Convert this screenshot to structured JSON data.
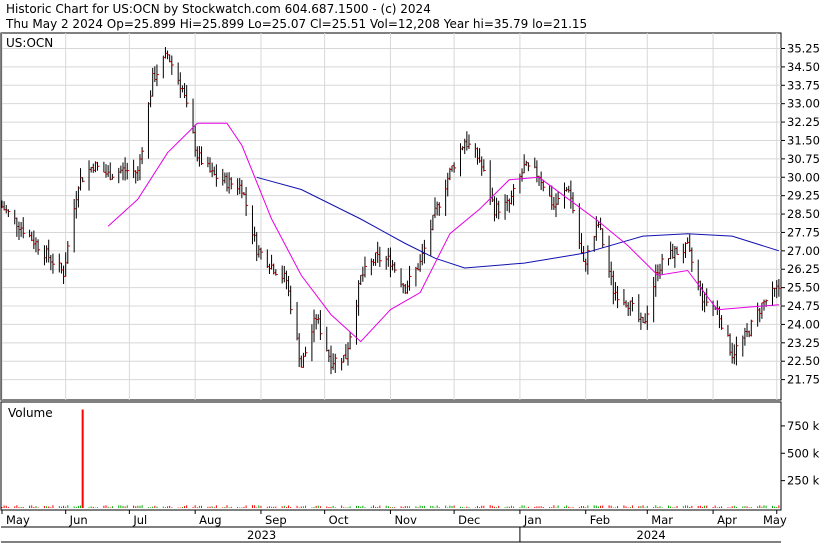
{
  "header": {
    "line1": "Historic Chart for US:OCN by Stockwatch.com 604.687.1500 - (c) 2024",
    "line2": "Thu May  2 2024  Op=25.899  Hi=25.899  Lo=25.07  Cl=25.51  Vol=12,208  Year hi=35.79  lo=21.15"
  },
  "chart_data": [
    {
      "type": "line",
      "title": "US:OCN",
      "ylim": [
        21.0,
        35.8
      ],
      "y_ticks": [
        "35.25",
        "34.50",
        "33.75",
        "33.00",
        "32.25",
        "31.50",
        "30.75",
        "30.00",
        "29.25",
        "28.50",
        "27.75",
        "27.00",
        "26.25",
        "25.50",
        "24.75",
        "24.00",
        "23.25",
        "22.50",
        "21.75"
      ],
      "x_ticks": [
        "May",
        "Jun",
        "Jul",
        "Aug",
        "Sep",
        "Oct",
        "Nov",
        "Dec",
        "Jan",
        "Feb",
        "Mar",
        "Apr",
        "May"
      ],
      "year_labels": [
        "2023",
        "2024"
      ],
      "series": [
        {
          "name": "price",
          "color": "#000000",
          "x": [
            "2023-05-02",
            "2023-05-15",
            "2023-05-31",
            "2023-06-07",
            "2023-06-14",
            "2023-06-21",
            "2023-06-28",
            "2023-07-05",
            "2023-07-12",
            "2023-07-19",
            "2023-07-26",
            "2023-08-02",
            "2023-08-09",
            "2023-08-16",
            "2023-08-23",
            "2023-08-30",
            "2023-09-06",
            "2023-09-13",
            "2023-09-20",
            "2023-09-27",
            "2023-10-04",
            "2023-10-11",
            "2023-10-18",
            "2023-10-25",
            "2023-11-01",
            "2023-11-08",
            "2023-11-15",
            "2023-11-22",
            "2023-11-29",
            "2023-12-06",
            "2023-12-13",
            "2023-12-20",
            "2023-12-27",
            "2024-01-03",
            "2024-01-10",
            "2024-01-17",
            "2024-01-24",
            "2024-01-31",
            "2024-02-07",
            "2024-02-14",
            "2024-02-21",
            "2024-02-28",
            "2024-03-06",
            "2024-03-13",
            "2024-03-20",
            "2024-03-27",
            "2024-04-03",
            "2024-04-10",
            "2024-04-17",
            "2024-04-24",
            "2024-05-02"
          ],
          "values": [
            28.8,
            27.6,
            26.1,
            29.8,
            30.5,
            30.1,
            30.3,
            30.2,
            34.0,
            35.0,
            33.6,
            30.9,
            30.1,
            29.8,
            29.6,
            27.1,
            26.4,
            25.8,
            22.3,
            24.3,
            22.5,
            22.7,
            25.9,
            26.7,
            26.6,
            25.5,
            26.5,
            28.5,
            30.2,
            31.5,
            30.7,
            28.7,
            28.9,
            30.4,
            30.1,
            28.8,
            29.6,
            26.4,
            28.1,
            25.4,
            24.9,
            23.9,
            26.3,
            26.9,
            27.1,
            25.1,
            24.6,
            22.8,
            23.6,
            24.8,
            25.5
          ]
        },
        {
          "name": "ma_short",
          "color": "#e600e6",
          "x": [
            "2023-06-21",
            "2023-07-05",
            "2023-07-19",
            "2023-07-26",
            "2023-08-02",
            "2023-08-16",
            "2023-08-23",
            "2023-09-06",
            "2023-09-20",
            "2023-10-04",
            "2023-10-18",
            "2023-11-01",
            "2023-11-15",
            "2023-11-29",
            "2023-12-13",
            "2023-12-27",
            "2024-01-10",
            "2024-01-24",
            "2024-02-07",
            "2024-02-21",
            "2024-03-06",
            "2024-03-20",
            "2024-04-03",
            "2024-04-17",
            "2024-05-02"
          ],
          "values": [
            28.0,
            29.1,
            31.0,
            31.6,
            32.2,
            32.2,
            31.3,
            28.3,
            26.0,
            24.4,
            23.3,
            24.6,
            25.3,
            27.7,
            28.7,
            29.9,
            30.0,
            29.1,
            28.2,
            27.2,
            26.0,
            26.2,
            24.6,
            24.7,
            24.8
          ]
        },
        {
          "name": "ma_long",
          "color": "#1010b0",
          "x": [
            "2023-08-30",
            "2023-09-20",
            "2023-10-18",
            "2023-11-08",
            "2023-11-22",
            "2023-12-06",
            "2024-01-03",
            "2024-01-31",
            "2024-02-28",
            "2024-03-20",
            "2024-04-10",
            "2024-05-02"
          ],
          "values": [
            30.0,
            29.5,
            28.3,
            27.3,
            26.7,
            26.3,
            26.5,
            26.9,
            27.6,
            27.7,
            27.6,
            27.0
          ]
        }
      ]
    },
    {
      "type": "bar",
      "title": "Volume",
      "ylim": [
        0,
        950
      ],
      "y_ticks": [
        "750 k",
        "500 k",
        "250 k"
      ],
      "spike": {
        "x": "2023-06-09",
        "value": 900,
        "color": "#ff0000"
      },
      "baseline_color": "#00aa00"
    }
  ]
}
